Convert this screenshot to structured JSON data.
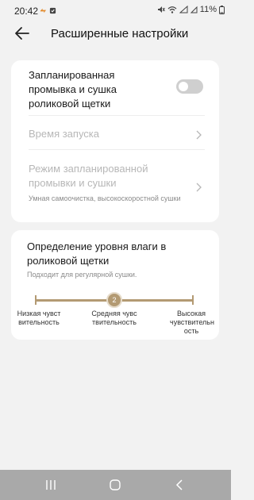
{
  "status": {
    "time": "20:42",
    "battery": "11%"
  },
  "header": {
    "title": "Расширенные настройки"
  },
  "card1": {
    "scheduled_wash_label": "Запланированная промывка и сушка роликовой щетки",
    "scheduled_wash_enabled": false,
    "start_time_label": "Время запуска",
    "scheduled_mode_label": "Режим запланированной промывки и сушки",
    "scheduled_mode_value": "Умная самоочистка, высокоскоростной сушки"
  },
  "card2": {
    "title": "Определение уровня влаги в роликовой щетки",
    "subtitle": "Подходит для регулярной сушки.",
    "slider": {
      "value": 2,
      "value_label": "2",
      "levels": 3,
      "low_label": "Низкая чувст вительность",
      "mid_label": "Средняя чувс твительность",
      "high_label": "Высокая чувствительн ость"
    }
  },
  "colors": {
    "accent": "#b39a73",
    "background": "#f2f2f2",
    "card": "#ffffff"
  }
}
